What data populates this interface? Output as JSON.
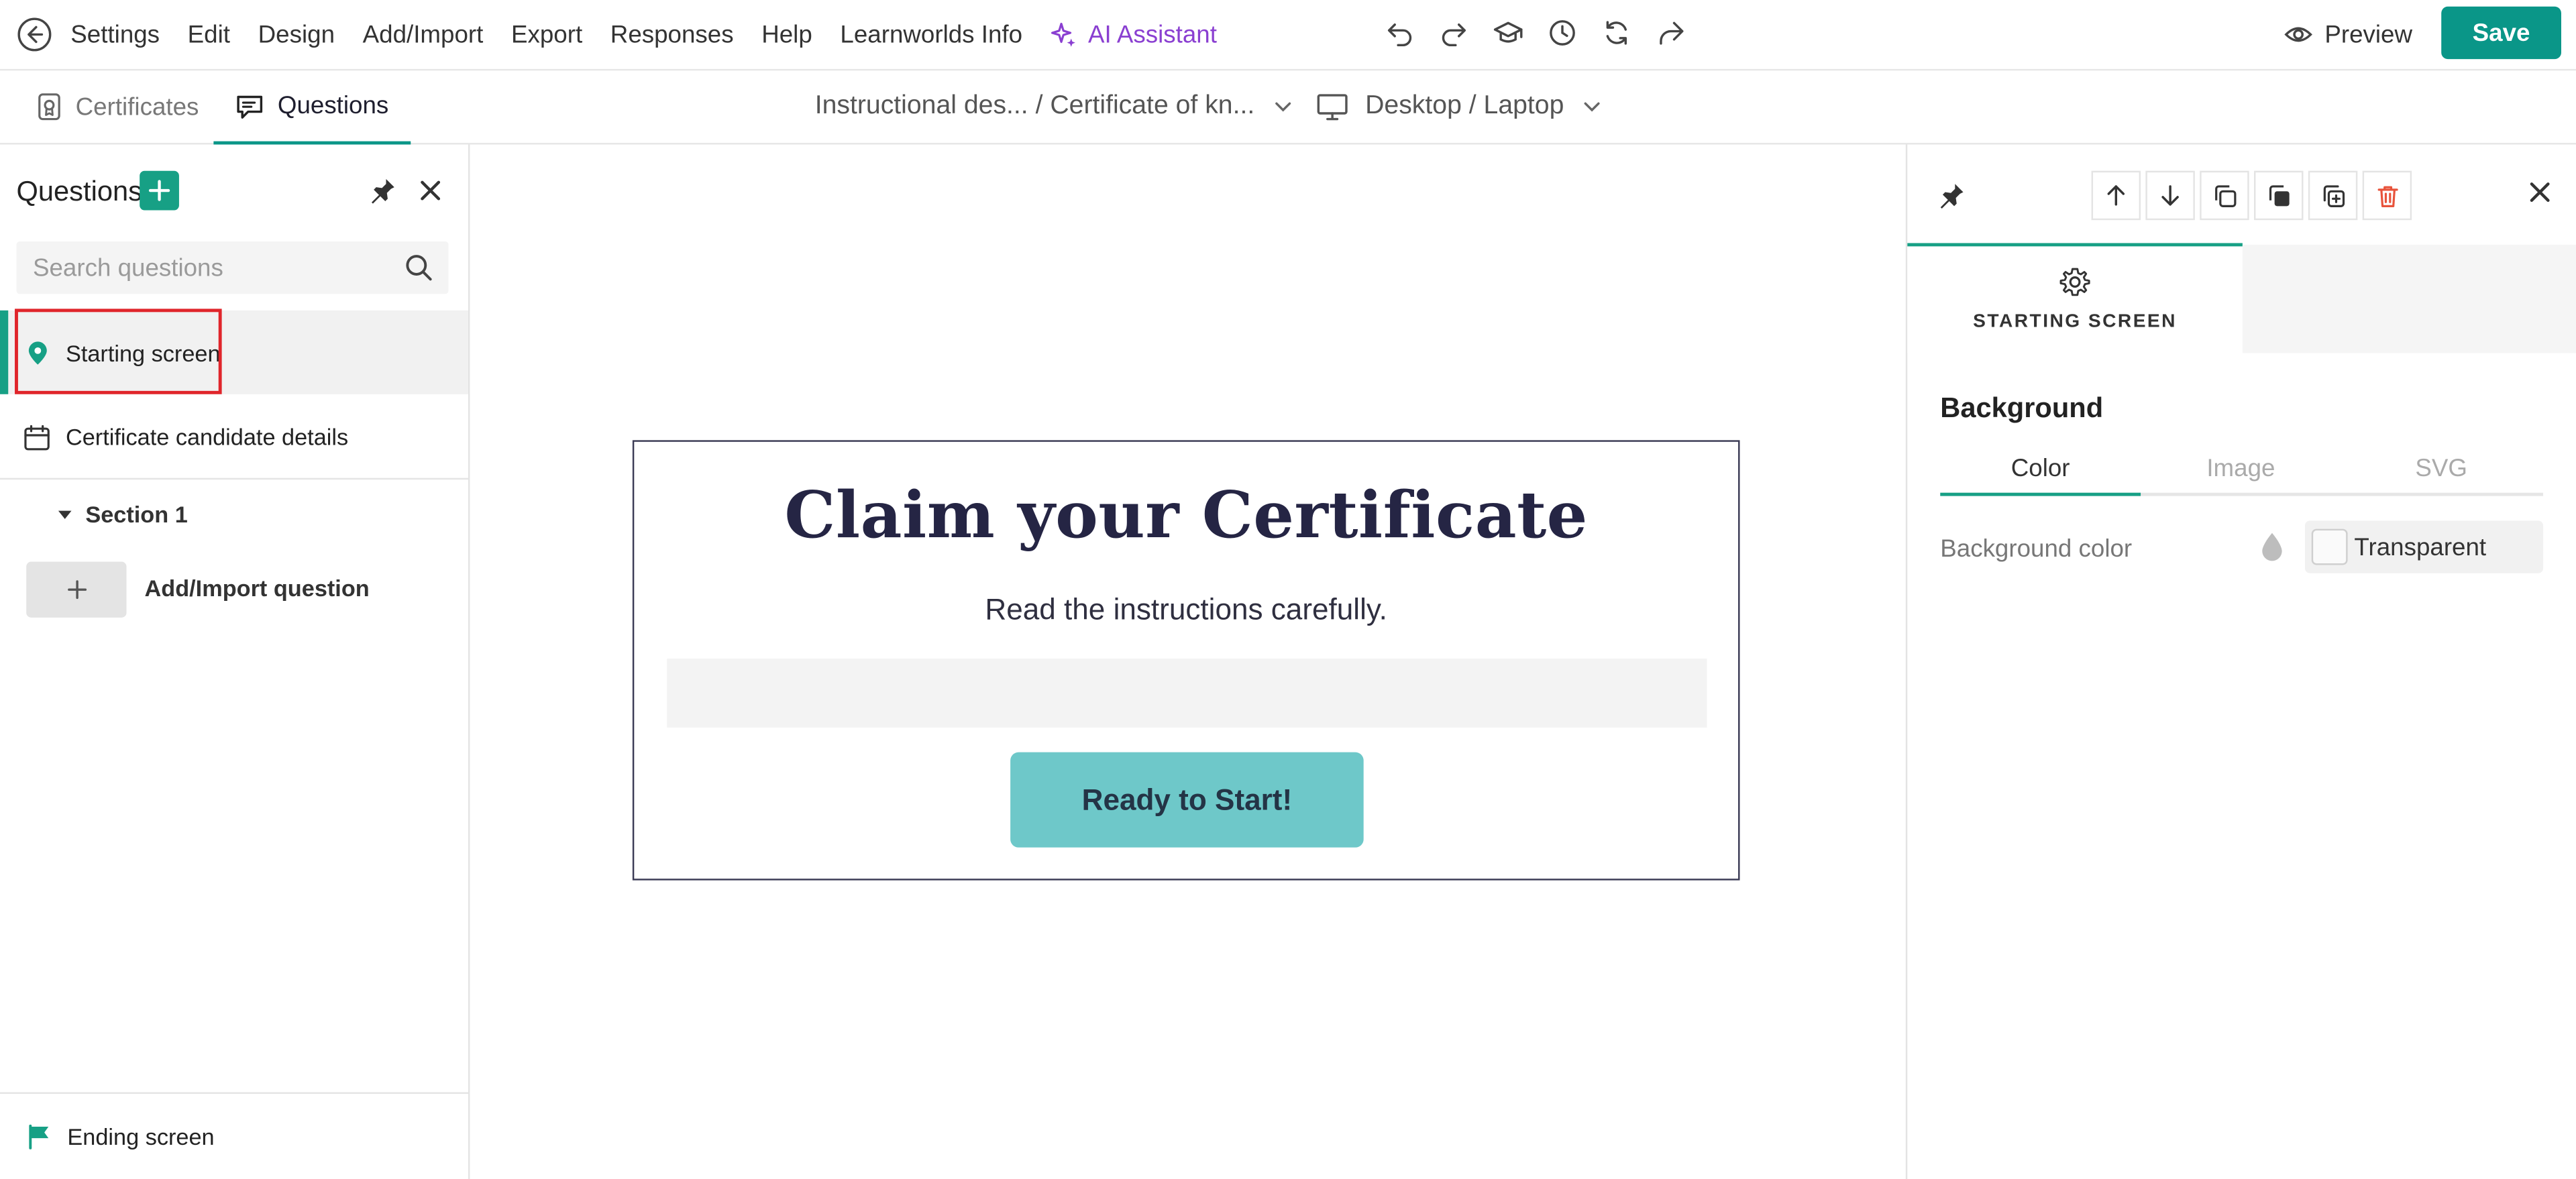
{
  "menu": {
    "items": [
      "Settings",
      "Edit",
      "Design",
      "Add/Import",
      "Export",
      "Responses",
      "Help",
      "Learnworlds Info"
    ],
    "ai_label": "AI Assistant"
  },
  "actions": {
    "preview_label": "Preview",
    "save_label": "Save"
  },
  "subbar": {
    "tab_certificates": "Certificates",
    "tab_questions": "Questions",
    "cert_selector": "Instructional des... / Certificate of kn...",
    "device_selector": "Desktop / Laptop"
  },
  "left_panel": {
    "title": "Questions",
    "search_placeholder": "Search questions",
    "items": {
      "starting": "Starting screen",
      "candidate": "Certificate candidate details",
      "section": "Section 1",
      "add_import": "Add/Import question",
      "ending": "Ending screen"
    }
  },
  "canvas": {
    "title": "Claim your Certificate",
    "subtitle": "Read the instructions carefully.",
    "button": "Ready to Start!"
  },
  "right_panel": {
    "tab_label": "STARTING SCREEN",
    "section_title": "Background",
    "subtabs": [
      "Color",
      "Image",
      "SVG"
    ],
    "bg_color_label": "Background color",
    "bg_color_value": "Transparent"
  },
  "colors": {
    "accent": "#0a9688",
    "ai": "#8a3fd1",
    "button": "#6ec8c9",
    "delete": "#e8533b",
    "highlight": "#e0252b"
  }
}
